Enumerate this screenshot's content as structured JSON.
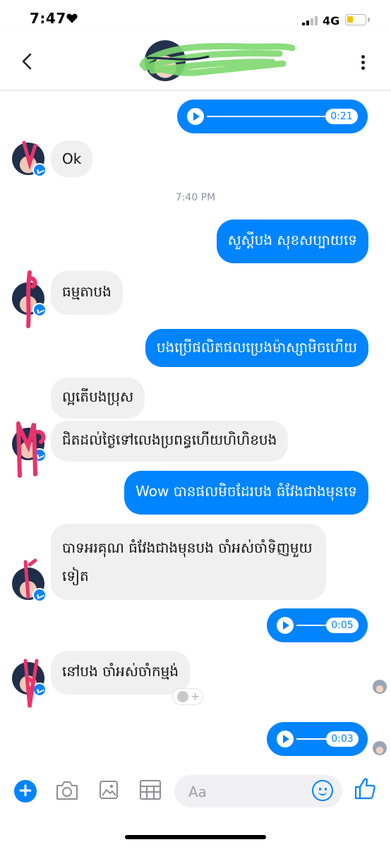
{
  "status_bar": {
    "time": "7:47",
    "network": "4G",
    "battery_level": 0.3
  },
  "header": {
    "back_label": "<"
  },
  "messages": {
    "voice_1_duration": "0:21",
    "recv_1": "Ok",
    "timestamp": "7:40 PM",
    "sent_1": "សួស្ដីបង សុខសប្បាយទេ",
    "recv_2": "ធម្មតាបង",
    "sent_2": "បងប្រើផលិតផលប្រេងម៉ាស្សាមិចហើយ",
    "recv_3a": "ល្អតើបងប្រុស",
    "recv_3b": "ជិតដល់ថ្ងៃទៅលេងប្រពន្ធហើយហិហិខបង",
    "sent_3": "Wow បានផលមិចដែរបង ធំវែងជាងមុនទេ",
    "recv_4": "បាទអរគុណ ធំវែងជាងមុនបង ចាំអស់ចាំទិញមួយទៀត",
    "voice_2_duration": "0:05",
    "recv_5": "នៅបង ចាំអស់ចាំកម្មង់",
    "voice_3_duration": "0:03"
  },
  "composer": {
    "placeholder": "Aa"
  },
  "colors": {
    "accent": "#0084ff",
    "received_bubble": "#f0f0f0"
  },
  "icons": [
    "back-icon",
    "more-icon",
    "plus-icon",
    "camera-icon",
    "gallery-icon",
    "sticker-icon",
    "emoji-icon",
    "like-icon"
  ]
}
